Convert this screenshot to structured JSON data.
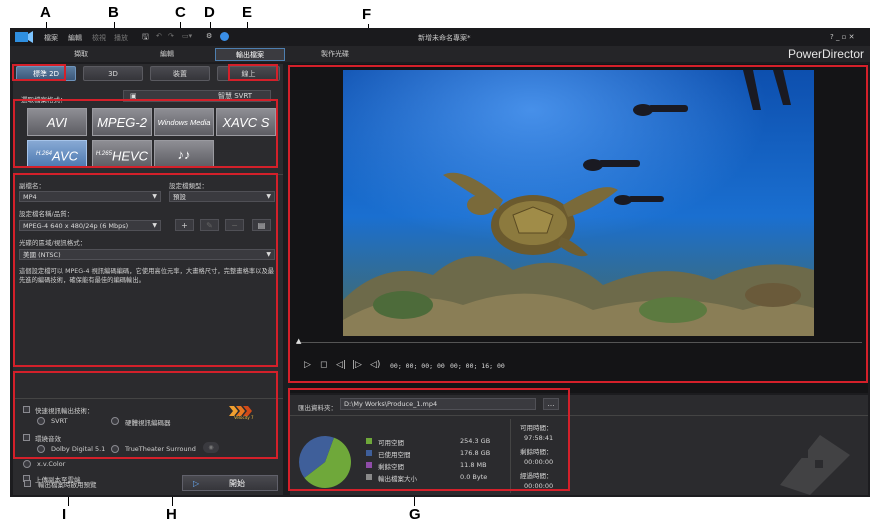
{
  "callouts": {
    "A": "A",
    "B": "B",
    "C": "C",
    "D": "D",
    "E": "E",
    "F": "F",
    "G": "G",
    "H": "H",
    "I": "I"
  },
  "titlebar": {
    "menu": [
      "檔案",
      "編輯",
      "檢視",
      "播放"
    ],
    "project_title": "新增未命名專案*",
    "window_controls": "? _ ▫ ✕"
  },
  "modes": [
    "擷取",
    "編輯",
    "輸出檔案",
    "製作光碟"
  ],
  "active_mode": "輸出檔案",
  "brand": "PowerDirector",
  "tabs": [
    "標準 2D",
    "3D",
    "裝置",
    "線上"
  ],
  "active_tab": "標準 2D",
  "select_format_label": "選取檔案格式：",
  "svrt_button": "智慧 SVRT",
  "formats": [
    {
      "sup": "",
      "label": "AVI",
      "selected": false
    },
    {
      "sup": "",
      "label": "MPEG-2",
      "selected": false
    },
    {
      "sup": "",
      "label": "Windows Media",
      "selected": false
    },
    {
      "sup": "",
      "label": "XAVC S",
      "selected": false
    },
    {
      "sup": "H.264",
      "label": "AVC",
      "selected": true
    },
    {
      "sup": "H.265",
      "label": "HEVC",
      "selected": false
    },
    {
      "sup": "",
      "label": "♪♪",
      "selected": false
    }
  ],
  "settings": {
    "ext_label": "副檔名：",
    "ext_value": "MP4",
    "profile_type_label": "設定檔類型：",
    "profile_type_value": "預設",
    "profile_label": "設定檔名稱/品質：",
    "profile_value": "MPEG-4 640 x 480/24p (6 Mbps)",
    "color_label": "光碟的區域/視訊格式：",
    "color_value": "美國 (NTSC)",
    "description": "這個設定檔可以 MPEG-4 視訊編碼編碼，它使用高位元率，大畫格尺寸，完整畫格率以及最先進的編碼技術，確保能有最佳的編碼輸出。"
  },
  "options": {
    "fast_render": "快速視訊輸出技術：",
    "svrt": "SVRT",
    "hw_encoder": "硬體視訊編碼器",
    "surround": "環繞音效",
    "dolby": "Dolby Digital 5.1",
    "truetheater": "TrueTheater Surround",
    "xvcolor": "x.v.Color",
    "upload": "上傳副本至雲端",
    "velocity_badge": "Velocity 7"
  },
  "footer": {
    "preview_checkbox": "輸出檔案時啟用預覽",
    "start_button": "開始"
  },
  "player": {
    "timecode_current": "00; 00; 00; 00",
    "timecode_total": "00; 00; 16; 00"
  },
  "output": {
    "folder_label": "匯出資料夾：",
    "folder_value": "D:\\My Works\\Produce_1.mp4",
    "browse": "…"
  },
  "disk": {
    "legend": [
      {
        "label": "可用空間",
        "value": "254.3  GB",
        "color": "#6fa83a"
      },
      {
        "label": "已使用空間",
        "value": "176.8  GB",
        "color": "#3f5f9a"
      },
      {
        "label": "剩餘空間",
        "value": "11.8  MB",
        "color": "#8f4ca8"
      },
      {
        "label": "輸出檔案大小",
        "value": "0.0  Byte",
        "color": "#8a8a8a"
      }
    ],
    "pie": {
      "free_fraction": 0.59,
      "used_fraction": 0.41
    },
    "time_labels": [
      {
        "label": "可用時間：",
        "value": "97:58:41"
      },
      {
        "label": "剩餘時間：",
        "value": "00:00:00"
      },
      {
        "label": "經過時間：",
        "value": "00:00:00"
      }
    ]
  }
}
